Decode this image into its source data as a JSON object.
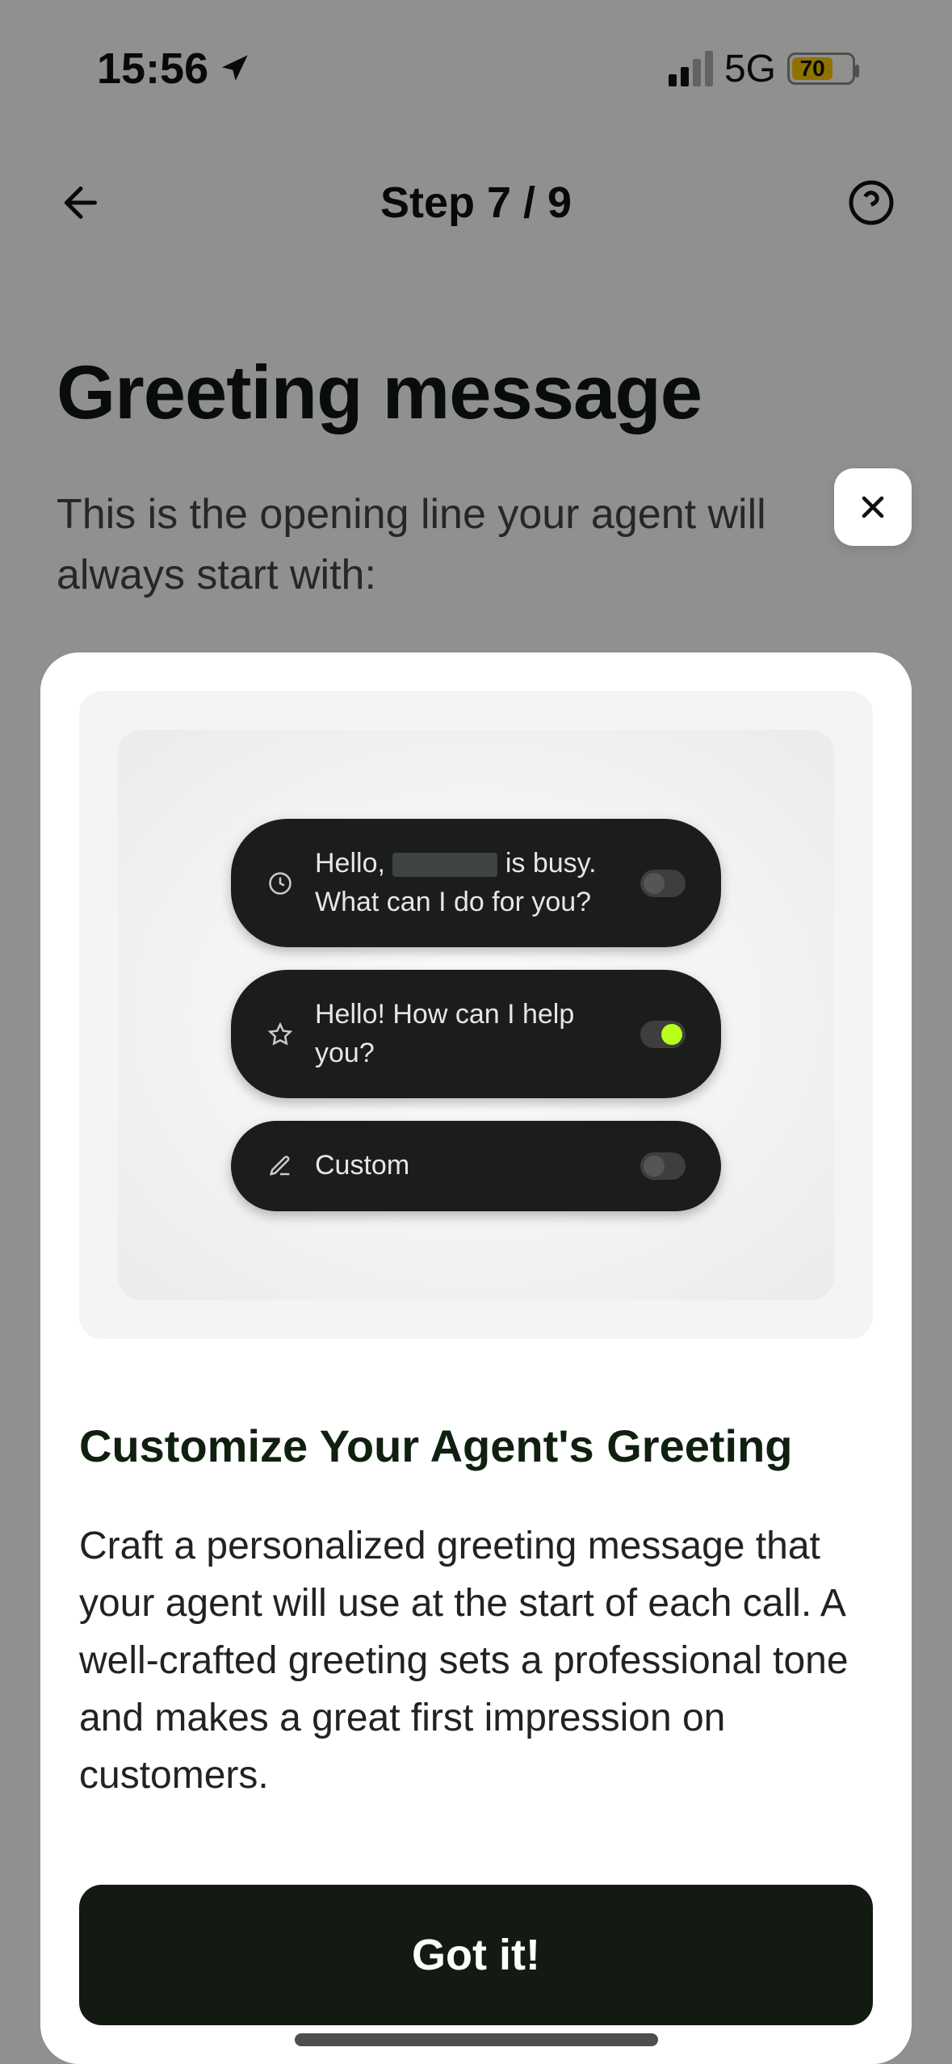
{
  "status": {
    "time": "15:56",
    "network": "5G",
    "battery_pct": "70"
  },
  "nav": {
    "step_label": "Step 7 / 9"
  },
  "page": {
    "title": "Greeting message",
    "subtitle": "This is the opening line your agent will always start with:"
  },
  "modal": {
    "illus": {
      "opt1_prefix": "Hello, ",
      "opt1_suffix": " is busy. What can I do for you?",
      "opt2": "Hello!  How can I help you?",
      "opt3": "Custom"
    },
    "title": "Customize Your Agent's Greeting",
    "body": "Craft a personalized greeting message that your agent will use at the start of each call. A well-crafted greeting sets a professional tone and makes a great first impression on customers.",
    "cta": "Got it!"
  }
}
